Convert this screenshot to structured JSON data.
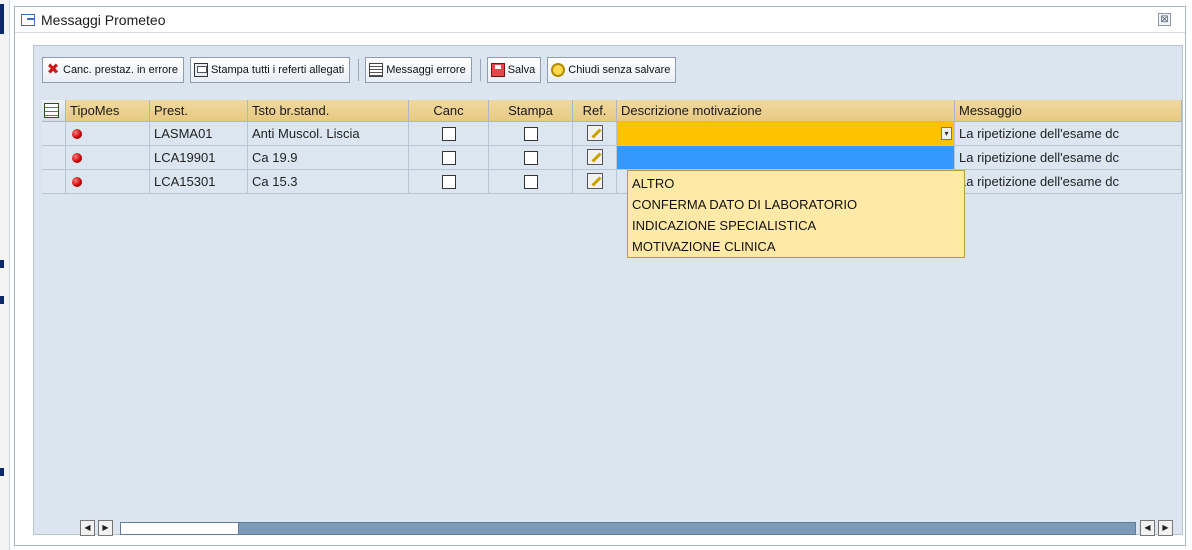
{
  "window": {
    "title": "Messaggi Prometeo",
    "close_glyph": "⊠"
  },
  "toolbar": {
    "buttons": [
      {
        "label": "Canc. prestaz. in errore",
        "icon": "delete-x-icon"
      },
      {
        "label": "Stampa tutti i referti allegati",
        "icon": "print-icon"
      },
      {
        "label": "Messaggi errore",
        "icon": "message-list-icon"
      },
      {
        "label": "Salva",
        "icon": "save-icon"
      },
      {
        "label": "Chiudi senza salvare",
        "icon": "exit-icon"
      }
    ]
  },
  "table": {
    "columns": [
      "TipoMes",
      "Prest.",
      "Tsto br.stand.",
      "Canc",
      "Stampa",
      "Ref.",
      "Descrizione motivazione",
      "Messaggio"
    ],
    "rows": [
      {
        "status": "error",
        "prest": "LASMA01",
        "tsto": "Anti Muscol. Liscia",
        "canc": false,
        "stampa": false,
        "descrizione": "",
        "messaggio": "La ripetizione dell'esame dc"
      },
      {
        "status": "error",
        "prest": "LCA19901",
        "tsto": "Ca 19.9",
        "canc": false,
        "stampa": false,
        "descrizione": "",
        "messaggio": "La ripetizione dell'esame dc"
      },
      {
        "status": "error",
        "prest": "LCA15301",
        "tsto": "Ca 15.3",
        "canc": false,
        "stampa": false,
        "descrizione": "",
        "messaggio": "La ripetizione dell'esame dc"
      }
    ]
  },
  "dropdown": {
    "options": [
      "ALTRO",
      "CONFERMA DATO DI LABORATORIO",
      "INDICAZIONE SPECIALISTICA",
      "MOTIVAZIONE CLINICA"
    ]
  },
  "colors": {
    "header": "#e8c982",
    "active_dropdown": "#ffc200",
    "highlight": "#3399ff",
    "dropdown_bg": "#ffe9a6",
    "error_dot": "#c00000"
  }
}
